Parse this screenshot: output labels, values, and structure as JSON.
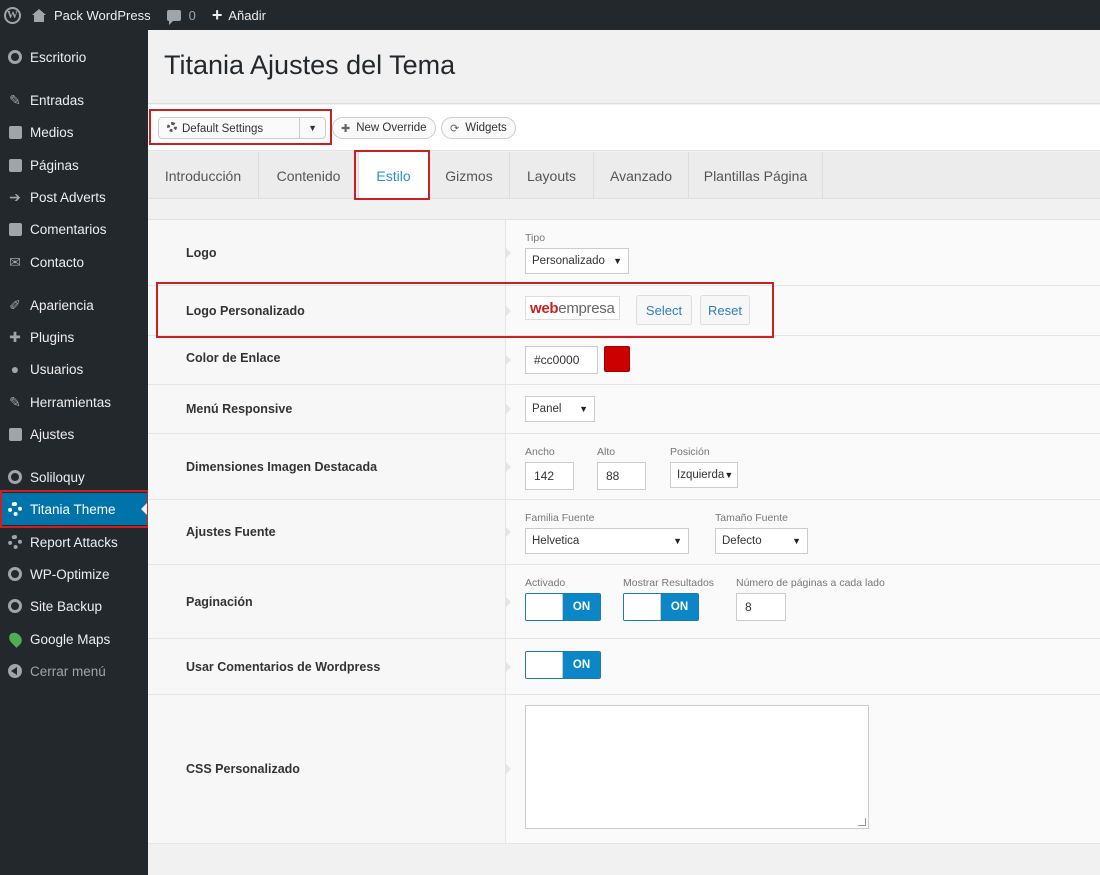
{
  "admin_bar": {
    "site_name": "Pack WordPress",
    "comments_count": "0",
    "add_new": "Añadir"
  },
  "sidebar": {
    "items": [
      {
        "label": "Escritorio",
        "icon": "dashboard-icon"
      },
      {
        "label": "Entradas",
        "icon": "pin-icon"
      },
      {
        "label": "Medios",
        "icon": "media-icon"
      },
      {
        "label": "Páginas",
        "icon": "pages-icon"
      },
      {
        "label": "Post Adverts",
        "icon": "arrow-right-box-icon"
      },
      {
        "label": "Comentarios",
        "icon": "comment-icon"
      },
      {
        "label": "Contacto",
        "icon": "mail-icon"
      },
      {
        "label": "Apariencia",
        "icon": "brush-icon"
      },
      {
        "label": "Plugins",
        "icon": "plug-icon"
      },
      {
        "label": "Usuarios",
        "icon": "user-icon"
      },
      {
        "label": "Herramientas",
        "icon": "wrench-icon"
      },
      {
        "label": "Ajustes",
        "icon": "settings-icon"
      },
      {
        "label": "Soliloquy",
        "icon": "ring-icon"
      },
      {
        "label": "Titania Theme",
        "icon": "gear-icon"
      },
      {
        "label": "Report Attacks",
        "icon": "gear-icon"
      },
      {
        "label": "WP-Optimize",
        "icon": "eye-icon"
      },
      {
        "label": "Site Backup",
        "icon": "history-icon"
      },
      {
        "label": "Google Maps",
        "icon": "map-pin-icon"
      },
      {
        "label": "Cerrar menú",
        "icon": "collapse-arrow-icon"
      }
    ]
  },
  "page": {
    "title": "Titania Ajustes del Tema"
  },
  "toolbar": {
    "settings_select": "Default Settings",
    "new_override": "New Override",
    "widgets": "Widgets"
  },
  "tabs": [
    "Introducción",
    "Contenido",
    "Estilo",
    "Gizmos",
    "Layouts",
    "Avanzado",
    "Plantillas Página"
  ],
  "active_tab": "Estilo",
  "settings": {
    "logo": {
      "label": "Logo",
      "tipo_label": "Tipo",
      "tipo_value": "Personalizado"
    },
    "logo_personalizado": {
      "label": "Logo Personalizado",
      "logo_text_a": "web",
      "logo_text_b": "empresa",
      "select_btn": "Select",
      "reset_btn": "Reset"
    },
    "color_enlace": {
      "label": "Color de Enlace",
      "value": "#cc0000"
    },
    "menu_responsive": {
      "label": "Menú Responsive",
      "value": "Panel"
    },
    "dimensiones": {
      "label": "Dimensiones Imagen Destacada",
      "ancho_label": "Ancho",
      "ancho_value": "142",
      "alto_label": "Alto",
      "alto_value": "88",
      "posicion_label": "Posición",
      "posicion_value": "Izquierda"
    },
    "ajustes_fuente": {
      "label": "Ajustes Fuente",
      "familia_label": "Familia Fuente",
      "familia_value": "Helvetica",
      "tamano_label": "Tamaño Fuente",
      "tamano_value": "Defecto"
    },
    "paginacion": {
      "label": "Paginación",
      "activado_label": "Activado",
      "activado_value": "ON",
      "mostrar_label": "Mostrar Resultados",
      "mostrar_value": "ON",
      "numero_label": "Número de páginas a cada lado",
      "numero_value": "8"
    },
    "comentarios": {
      "label": "Usar Comentarios de Wordpress",
      "value": "ON"
    },
    "css": {
      "label": "CSS Personalizado",
      "value": ""
    }
  },
  "colors": {
    "adminbar_bg": "#23282d",
    "accent_blue": "#0073aa",
    "highlight_red": "#cc1f1f",
    "link_color_swatch": "#cc0000"
  }
}
